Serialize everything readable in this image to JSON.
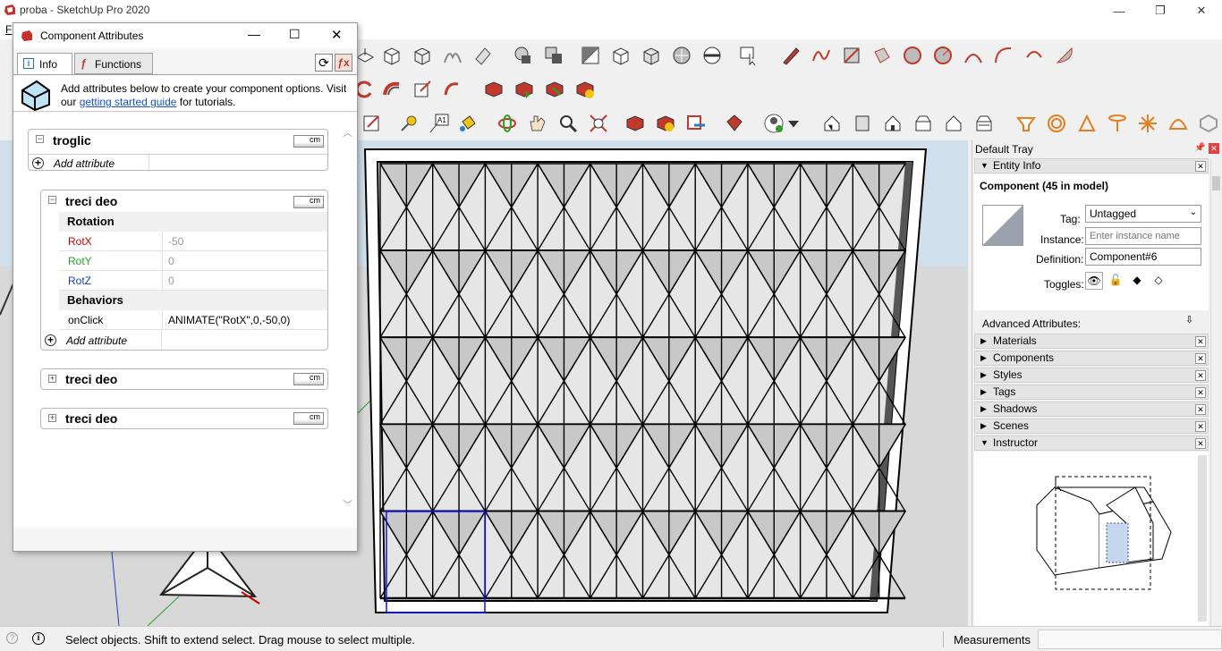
{
  "window": {
    "title": "proba - SketchUp Pro 2020",
    "menu_first_letter": "F"
  },
  "dialog": {
    "title": "Component Attributes",
    "tabs": [
      {
        "label": "Info"
      },
      {
        "label": "Functions"
      }
    ],
    "info_text": "Add attributes below to create your component options. Visit our",
    "info_link": "getting started guide",
    "info_suffix": "for tutorials.",
    "unit": "cm",
    "components": [
      {
        "name": "troglic",
        "add_label": "Add attribute"
      },
      {
        "name": "treci deo",
        "groups": [
          {
            "group": "Rotation",
            "rows": [
              {
                "key": "RotX",
                "value": "-50",
                "color": "#c00000"
              },
              {
                "key": "RotY",
                "value": "0",
                "color": "#2a9d2a"
              },
              {
                "key": "RotZ",
                "value": "0",
                "color": "#1f3fb5"
              }
            ]
          },
          {
            "group": "Behaviors",
            "rows": [
              {
                "key": "onClick",
                "value": "ANIMATE(\"RotX\",0,-50,0)",
                "color": "#000000"
              }
            ]
          }
        ],
        "add_label": "Add attribute"
      },
      {
        "name": "treci deo"
      },
      {
        "name": "treci deo"
      }
    ]
  },
  "tray": {
    "title": "Default Tray",
    "entity_info": {
      "header": "Entity Info",
      "selection": "Component (45 in model)",
      "tag_label": "Tag:",
      "tag_value": "Untagged",
      "instance_label": "Instance:",
      "instance_placeholder": "Enter instance name",
      "definition_label": "Definition:",
      "definition_value": "Component#6",
      "toggles_label": "Toggles:",
      "advanced_label": "Advanced Attributes:"
    },
    "panels": [
      "Materials",
      "Components",
      "Styles",
      "Tags",
      "Shadows",
      "Scenes",
      "Instructor"
    ]
  },
  "status": {
    "text": "Select objects. Shift to extend select. Drag mouse to select multiple.",
    "measurements_label": "Measurements",
    "measurements_value": ""
  },
  "colors": {
    "accent_red": "#c0392b",
    "selection_blue": "#1010ff",
    "link": "#1a4fc8"
  }
}
